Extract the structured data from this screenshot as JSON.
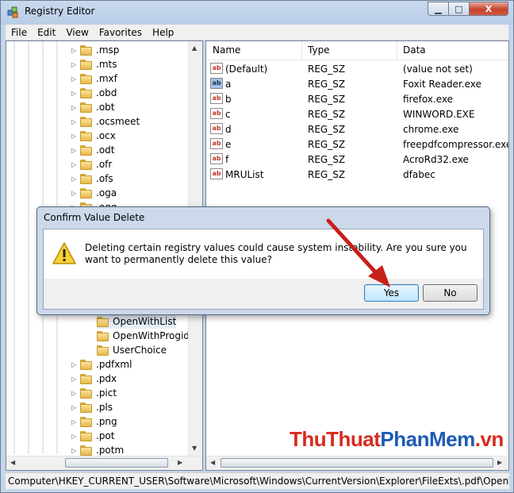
{
  "window": {
    "title": "Registry Editor",
    "minimize": "▭",
    "maximize": "□",
    "close": "X"
  },
  "menu": [
    "File",
    "Edit",
    "View",
    "Favorites",
    "Help"
  ],
  "tree": {
    "items": [
      ".msp",
      ".mts",
      ".mxf",
      ".obd",
      ".obt",
      ".ocsmeet",
      ".ocx",
      ".odt",
      ".ofr",
      ".ofs",
      ".oga",
      ".ogg"
    ],
    "children": [
      "OpenWithList",
      "OpenWithProgids",
      "UserChoice"
    ],
    "items_after": [
      ".pdfxml",
      ".pdx",
      ".pict",
      ".pls",
      ".png",
      ".pot",
      ".potm"
    ]
  },
  "list": {
    "columns": [
      "Name",
      "Type",
      "Data"
    ],
    "rows": [
      {
        "name": "(Default)",
        "type": "REG_SZ",
        "data": "(value not set)"
      },
      {
        "name": "a",
        "type": "REG_SZ",
        "data": "Foxit Reader.exe"
      },
      {
        "name": "b",
        "type": "REG_SZ",
        "data": "firefox.exe"
      },
      {
        "name": "c",
        "type": "REG_SZ",
        "data": "WINWORD.EXE"
      },
      {
        "name": "d",
        "type": "REG_SZ",
        "data": "chrome.exe"
      },
      {
        "name": "e",
        "type": "REG_SZ",
        "data": "freepdfcompressor.exe"
      },
      {
        "name": "f",
        "type": "REG_SZ",
        "data": "AcroRd32.exe"
      },
      {
        "name": "MRUList",
        "type": "REG_SZ",
        "data": "dfabec"
      }
    ],
    "icon_label": "ab"
  },
  "status": "Computer\\HKEY_CURRENT_USER\\Software\\Microsoft\\Windows\\CurrentVersion\\Explorer\\FileExts\\.pdf\\OpenWithList",
  "dialog": {
    "title": "Confirm Value Delete",
    "message": "Deleting certain registry values could cause system instability. Are you sure you want to permanently delete this value?",
    "yes": "Yes",
    "no": "No"
  },
  "watermark": {
    "part1": "ThuThuat",
    "part2": "PhanMem",
    "part3": ".vn"
  },
  "colors": {
    "accent_red": "#d62b20",
    "accent_blue": "#1f5bb5",
    "close_button": "#c7432c"
  }
}
